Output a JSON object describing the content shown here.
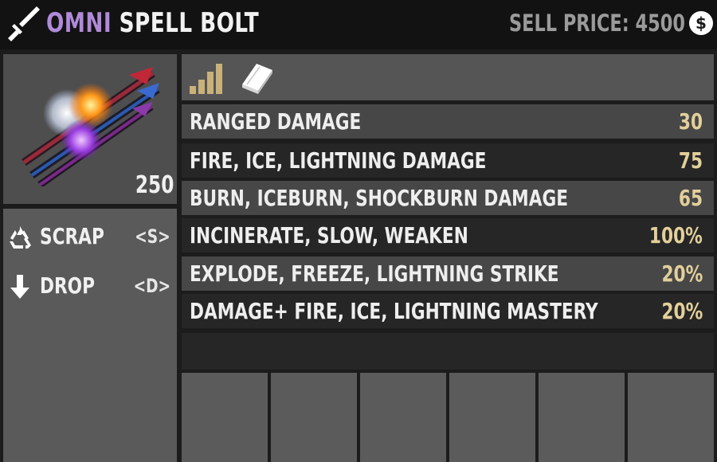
{
  "header": {
    "item_tier": "OMNI",
    "item_name": "SPELL BOLT",
    "sell_label": "SELL PRICE:",
    "sell_value": "4500",
    "item_icon": "dagger-icon",
    "currency_icon": "dollar-coin-icon"
  },
  "preview": {
    "image": "spell-bolt-arrows-image",
    "quantity": "250"
  },
  "actions": [
    {
      "icon": "recycle-icon",
      "label": "SCRAP",
      "key": "<S>"
    },
    {
      "icon": "arrow-down-icon",
      "label": "DROP",
      "key": "<D>"
    }
  ],
  "quality": {
    "icon": "quality-bars-icon",
    "book_icon": "book-icon"
  },
  "stats": [
    {
      "label": "RANGED DAMAGE",
      "value": "30"
    },
    {
      "label": "FIRE, ICE, LIGHTNING DAMAGE",
      "value": "75"
    },
    {
      "label": "BURN, ICEBURN, SHOCKBURN DAMAGE",
      "value": "65"
    },
    {
      "label": "INCINERATE, SLOW, WEAKEN",
      "value": "100%"
    },
    {
      "label": "EXPLODE, FREEZE, LIGHTNING STRIKE",
      "value": "20%"
    },
    {
      "label": "DAMAGE+ FIRE, ICE, LIGHTNING MASTERY",
      "value": "20%"
    }
  ],
  "mod_slots": [
    "",
    "",
    "",
    "",
    "",
    ""
  ],
  "colors": {
    "tier": "#b08ad8",
    "stat_value": "#e2cf9a",
    "quality": "#c8b27a"
  }
}
